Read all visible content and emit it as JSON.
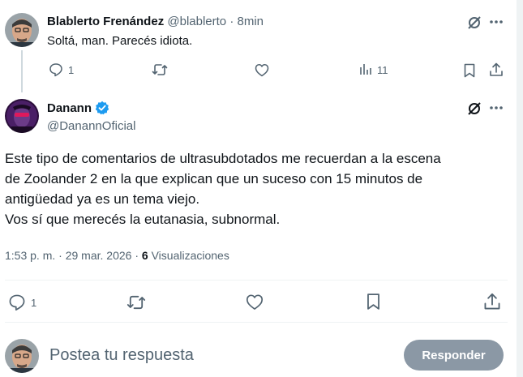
{
  "reply_tweet": {
    "display_name": "Blablerto Frenández",
    "handle": "@blablerto",
    "separator": "·",
    "time": "8min",
    "text": "Soltá, man. Parecés idiota.",
    "reply_count": "1",
    "views_count": "11"
  },
  "main_tweet": {
    "display_name": "Danann",
    "handle": "@DanannOficial",
    "text_lines": [
      "Este tipo de comentarios de ultrasubdotados me recuerdan a la escena",
      "de Zoolander 2 en la que explican que un suceso con 15 minutos de",
      "antigüedad ya es un tema viejo.",
      "Vos sí que merecés la eutanasia, subnormal."
    ],
    "time": "1:53 p. m.",
    "date": "29 mar. 2026",
    "dot": "·",
    "views_number": "6",
    "views_label": "Visualizaciones",
    "reply_count": "1"
  },
  "composer": {
    "placeholder": "Postea tu respuesta",
    "submit_label": "Responder"
  },
  "colors": {
    "muted": "#536471",
    "verified": "#1d9bf0",
    "submit_bg": "#8b98a5",
    "divider": "#eff3f4"
  },
  "icons": [
    "grok-icon",
    "more-icon",
    "reply-icon",
    "retweet-icon",
    "like-icon",
    "views-icon",
    "bookmark-icon",
    "share-icon",
    "verified-badge-icon"
  ]
}
